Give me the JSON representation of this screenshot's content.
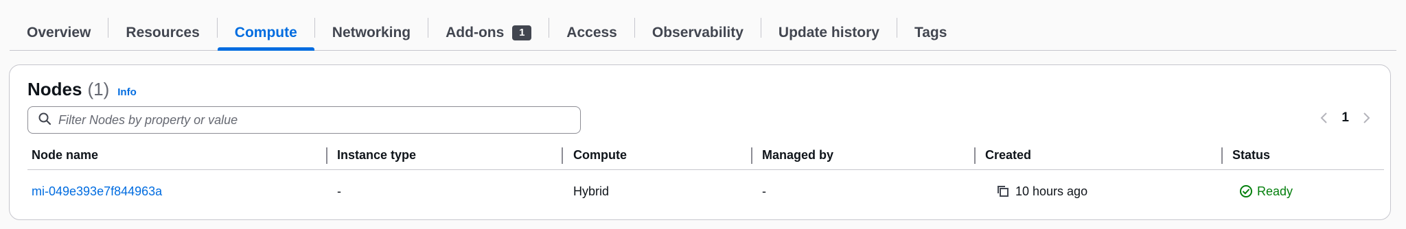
{
  "tabs": [
    {
      "label": "Overview",
      "active": false
    },
    {
      "label": "Resources",
      "active": false
    },
    {
      "label": "Compute",
      "active": true
    },
    {
      "label": "Networking",
      "active": false
    },
    {
      "label": "Add-ons",
      "active": false,
      "badge": "1"
    },
    {
      "label": "Access",
      "active": false
    },
    {
      "label": "Observability",
      "active": false
    },
    {
      "label": "Update history",
      "active": false
    },
    {
      "label": "Tags",
      "active": false
    }
  ],
  "nodes": {
    "title": "Nodes",
    "count": "(1)",
    "info_label": "Info",
    "filter_placeholder": "Filter Nodes by property or value",
    "pagination": {
      "current_page": "1"
    },
    "columns": {
      "node_name": "Node name",
      "instance_type": "Instance type",
      "compute": "Compute",
      "managed_by": "Managed by",
      "created": "Created",
      "status": "Status"
    },
    "rows": [
      {
        "node_name": "mi-049e393e7f844963a",
        "instance_type": "-",
        "compute": "Hybrid",
        "managed_by": "-",
        "created": "10 hours ago",
        "status": "Ready"
      }
    ]
  },
  "colors": {
    "accent": "#006ce0",
    "success": "#037f0c",
    "border": "#c6c6cd",
    "text": "#0f141a"
  },
  "icons": {
    "search": "search-icon",
    "sort_asc": "sort-ascending-icon",
    "sort_none": "sort-unsorted-icon",
    "copy": "copy-icon",
    "status_ok": "status-positive-icon",
    "prev": "chevron-left-icon",
    "next": "chevron-right-icon"
  }
}
